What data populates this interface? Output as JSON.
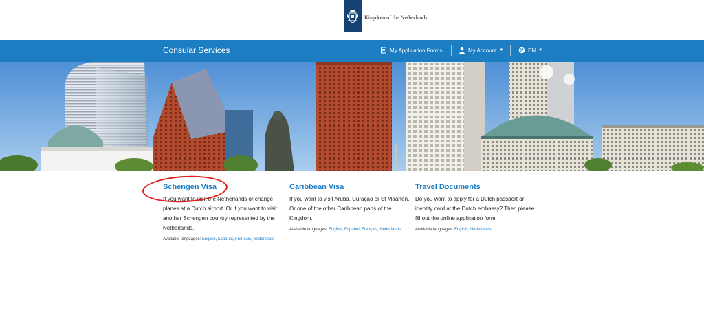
{
  "header": {
    "logo_text": "Kingdom of the Netherlands"
  },
  "nav": {
    "title": "Consular Services",
    "forms": "My Application Forms",
    "account": "My Account",
    "language": "EN"
  },
  "cards": [
    {
      "title": "Schengen Visa",
      "description": "If you want to visit the Netherlands or change planes at a Dutch airport. Or if you want to visit another Schengen country represented by the Netherlands.",
      "langs_label": "Available languages:",
      "langs": [
        "English",
        "Español",
        "Français",
        "Nederlands"
      ]
    },
    {
      "title": "Caribbean Visa",
      "description": "If you want to visit Aruba, Curaçao or St Maarten. Or one of the other Caribbean parts of the Kingdom.",
      "langs_label": "Available languages:",
      "langs": [
        "English",
        "Español",
        "Français",
        "Nederlands"
      ]
    },
    {
      "title": "Travel Documents",
      "description": "Do you want to apply for a Dutch passport or identity card at the Dutch embassy? Then please fill out the online application form.",
      "langs_label": "Available languages:",
      "langs": [
        "English",
        "Nederlands"
      ]
    }
  ],
  "colors": {
    "brand_blue": "#1c7dc3",
    "logo_navy": "#154273",
    "highlight_red": "#e0201b"
  }
}
